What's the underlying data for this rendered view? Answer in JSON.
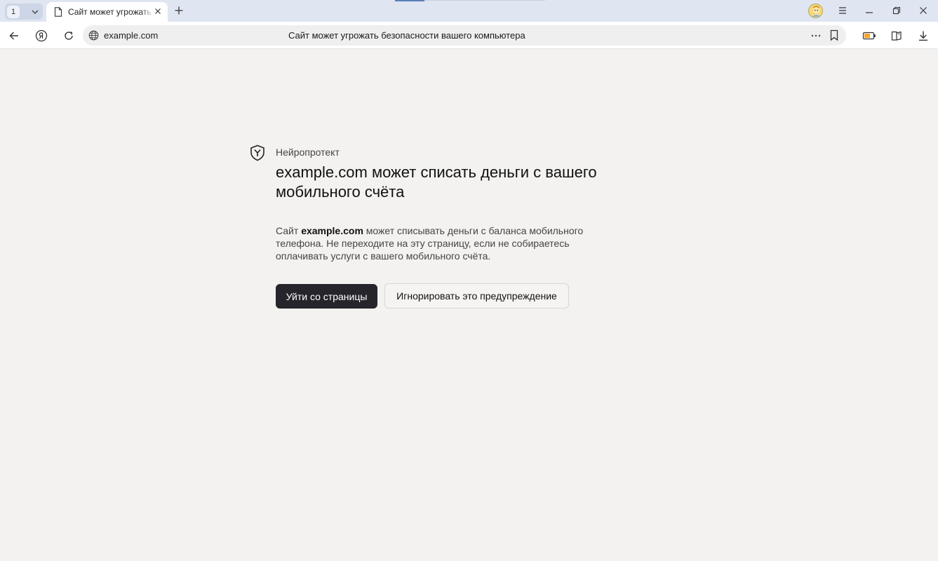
{
  "tabs": {
    "count": "1",
    "active_title": "Сайт может угрожать безопасности вашего компьютера"
  },
  "toolbar": {
    "url": "example.com",
    "page_title": "Сайт может угрожать безопасности вашего компьютера"
  },
  "warning": {
    "brand": "Нейропротект",
    "headline": "example.com может списать деньги с вашего мобильного счёта",
    "desc_prefix": "Сайт ",
    "desc_domain": "example.com",
    "desc_suffix": " может списывать деньги с баланса мобильного телефона. Не переходите на эту страницу, если не собираетесь оплачивать услуги с вашего мобильного счёта.",
    "leave_label": "Уйти со страницы",
    "ignore_label": "Игнорировать это предупреждение"
  },
  "colors": {
    "page_bg": "#f3f2f0",
    "tabstrip_bg": "#dfe6f2",
    "primary_button": "#26252c",
    "battery_accent": "#f5a623"
  },
  "icons": {
    "tab": "document-icon",
    "back": "back-arrow-icon",
    "yandex": "yandex-logo-icon",
    "reload": "reload-icon",
    "site": "globe-icon",
    "more": "more-dots-icon",
    "bookmark": "bookmark-icon",
    "battery": "battery-saver-icon",
    "collections": "collections-icon",
    "downloads": "download-icon",
    "protect": "shield-icon"
  }
}
